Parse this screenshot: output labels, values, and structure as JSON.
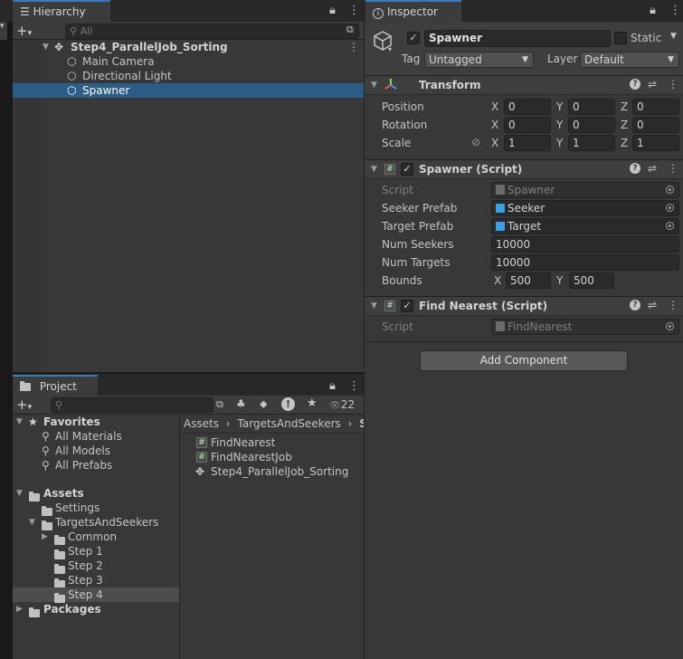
{
  "hierarchy": {
    "tab_label": "Hierarchy",
    "search_placeholder": "All",
    "scene_name": "Step4_ParallelJob_Sorting",
    "items": [
      "Main Camera",
      "Directional Light",
      "Spawner"
    ],
    "selected": "Spawner"
  },
  "project": {
    "tab_label": "Project",
    "hidden_count": "22",
    "favorites": {
      "label": "Favorites",
      "items": [
        "All Materials",
        "All Models",
        "All Prefabs"
      ]
    },
    "assets": {
      "label": "Assets",
      "settings": "Settings",
      "targets": "TargetsAndSeekers",
      "common": "Common",
      "steps": [
        "Step 1",
        "Step 2",
        "Step 3",
        "Step 4"
      ],
      "packages": "Packages"
    },
    "breadcrumb": [
      "Assets",
      "TargetsAndSeekers",
      "St"
    ],
    "files": [
      "FindNearest",
      "FindNearestJob",
      "Step4_ParallelJob_Sorting"
    ]
  },
  "inspector": {
    "tab_label": "Inspector",
    "object_name": "Spawner",
    "static_label": "Static",
    "tag_label": "Tag",
    "tag_value": "Untagged",
    "layer_label": "Layer",
    "layer_value": "Default",
    "transform": {
      "title": "Transform",
      "position_label": "Position",
      "rotation_label": "Rotation",
      "scale_label": "Scale",
      "x": "X",
      "y": "Y",
      "z": "Z",
      "position": [
        "0",
        "0",
        "0"
      ],
      "rotation": [
        "0",
        "0",
        "0"
      ],
      "scale": [
        "1",
        "1",
        "1"
      ]
    },
    "spawner": {
      "title": "Spawner (Script)",
      "script_label": "Script",
      "script_value": "Spawner",
      "seeker_label": "Seeker Prefab",
      "seeker_value": "Seeker",
      "target_label": "Target Prefab",
      "target_value": "Target",
      "num_seekers_label": "Num Seekers",
      "num_seekers": "10000",
      "num_targets_label": "Num Targets",
      "num_targets": "10000",
      "bounds_label": "Bounds",
      "bounds_x_label": "X",
      "bounds_x": "500",
      "bounds_y_label": "Y",
      "bounds_y": "500"
    },
    "find_nearest": {
      "title": "Find Nearest (Script)",
      "script_label": "Script",
      "script_value": "FindNearest"
    },
    "add_component": "Add Component"
  },
  "icons": {
    "lock": "lock-icon",
    "menu": "kebab-menu-icon",
    "help": "help-icon",
    "presets": "presets-icon"
  },
  "colors": {
    "selection": "#2c5d87",
    "tab_accent": "#3a79bb",
    "panel_bg": "#383838"
  }
}
